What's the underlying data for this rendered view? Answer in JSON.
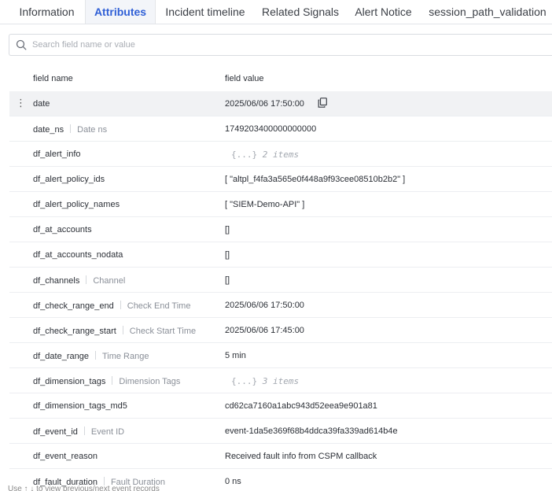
{
  "tabs": [
    {
      "label": "Information"
    },
    {
      "label": "Attributes",
      "active": true
    },
    {
      "label": "Incident timeline"
    },
    {
      "label": "Related Signals"
    },
    {
      "label": "Alert Notice"
    },
    {
      "label": "session_path_validation"
    }
  ],
  "search": {
    "placeholder": "Search field name or value",
    "icon": "search-icon"
  },
  "table": {
    "headers": {
      "name": "field name",
      "value": "field value"
    },
    "rows": [
      {
        "name": "date",
        "alias": "",
        "value": "2025/06/06 17:50:00",
        "highlight": true,
        "copy": true
      },
      {
        "name": "date_ns",
        "alias": "Date ns",
        "value": "1749203400000000000"
      },
      {
        "name": "df_alert_info",
        "alias": "",
        "value": "{...}",
        "count": "2 items",
        "object": true
      },
      {
        "name": "df_alert_policy_ids",
        "alias": "",
        "value": "[ \"altpl_f4fa3a565e0f448a9f93cee08510b2b2\" ]"
      },
      {
        "name": "df_alert_policy_names",
        "alias": "",
        "value": "[ \"SIEM-Demo-API\" ]"
      },
      {
        "name": "df_at_accounts",
        "alias": "",
        "value": "[]"
      },
      {
        "name": "df_at_accounts_nodata",
        "alias": "",
        "value": "[]"
      },
      {
        "name": "df_channels",
        "alias": "Channel",
        "value": "[]"
      },
      {
        "name": "df_check_range_end",
        "alias": "Check End Time",
        "value": "2025/06/06 17:50:00"
      },
      {
        "name": "df_check_range_start",
        "alias": "Check Start Time",
        "value": "2025/06/06 17:45:00"
      },
      {
        "name": "df_date_range",
        "alias": "Time Range",
        "value": "5 min"
      },
      {
        "name": "df_dimension_tags",
        "alias": "Dimension Tags",
        "value": "{...}",
        "count": "3 items",
        "object": true
      },
      {
        "name": "df_dimension_tags_md5",
        "alias": "",
        "value": "cd62ca7160a1abc943d52eea9e901a81"
      },
      {
        "name": "df_event_id",
        "alias": "Event ID",
        "value": "event-1da5e369f68b4ddca39fa339ad614b4e"
      },
      {
        "name": "df_event_reason",
        "alias": "",
        "value": "Received fault info from CSPM callback"
      },
      {
        "name": "df_fault_duration",
        "alias": "Fault Duration",
        "value": "0 ns"
      }
    ]
  },
  "footer": {
    "hint": "Use ↑ ↓ to view previous/next event records"
  }
}
